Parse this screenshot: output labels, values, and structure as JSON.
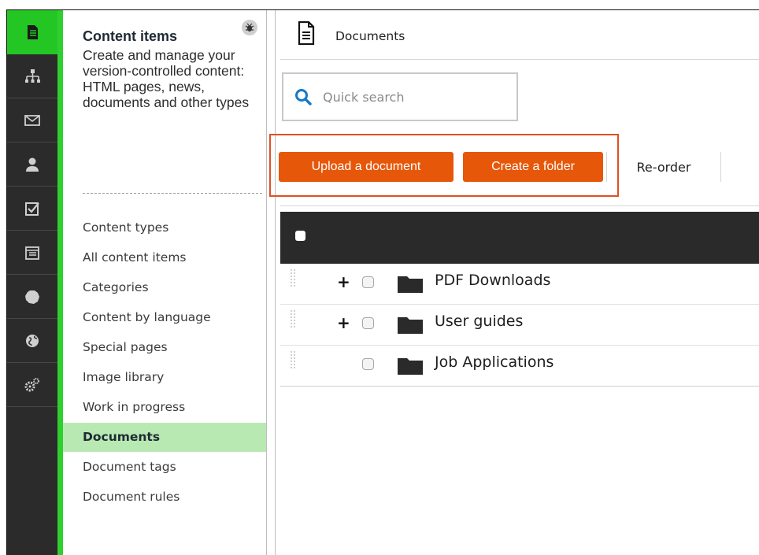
{
  "rail": {
    "items": [
      {
        "icon": "document-icon",
        "active": true
      },
      {
        "icon": "sitemap-icon",
        "active": false
      },
      {
        "icon": "mail-icon",
        "active": false
      },
      {
        "icon": "user-icon",
        "active": false
      },
      {
        "icon": "checkbox-icon",
        "active": false
      },
      {
        "icon": "calendar-icon",
        "active": false
      },
      {
        "icon": "blob-icon",
        "active": false
      },
      {
        "icon": "globe-icon",
        "active": false
      },
      {
        "icon": "settings-icon",
        "active": false
      }
    ],
    "accent": "#23c623"
  },
  "nav": {
    "title": "Content items",
    "description": "Create and manage your version-controlled content: HTML pages, news, documents and other types",
    "items": [
      {
        "label": "Content types"
      },
      {
        "label": "All content items"
      },
      {
        "label": "Categories"
      },
      {
        "label": "Content by language"
      },
      {
        "label": "Special pages"
      },
      {
        "label": "Image library"
      },
      {
        "label": "Work in progress"
      },
      {
        "label": "Documents",
        "active": true
      },
      {
        "label": "Document tags"
      },
      {
        "label": "Document rules"
      }
    ]
  },
  "header": {
    "title": "Documents"
  },
  "search": {
    "placeholder": "Quick search"
  },
  "toolbar": {
    "upload_label": "Upload a document",
    "folder_label": "Create a folder",
    "reorder_label": "Re-order",
    "button_color": "#e6570a",
    "highlight_color": "#e05024"
  },
  "table": {
    "rows": [
      {
        "name": "PDF Downloads",
        "expandable": true
      },
      {
        "name": "User guides",
        "expandable": true
      },
      {
        "name": "Job Applications",
        "expandable": false
      }
    ]
  }
}
